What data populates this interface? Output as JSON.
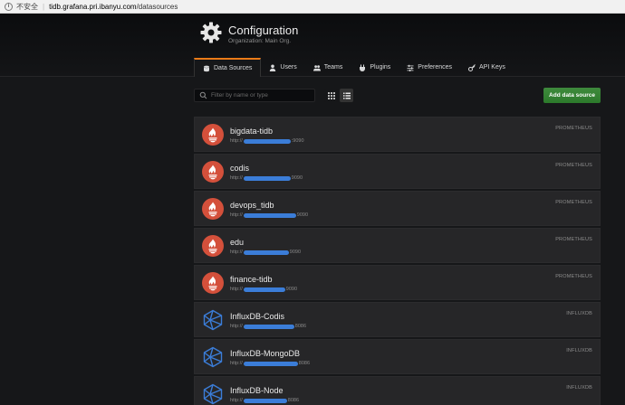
{
  "browser": {
    "security_label": "不安全",
    "url_host": "tidb.grafana.pri.ibanyu.com",
    "url_path": "/datasources"
  },
  "header": {
    "icon": "gear-icon",
    "title": "Configuration",
    "subtitle": "Organization: Main Org."
  },
  "tabs": [
    {
      "label": "Data Sources",
      "icon": "database-icon",
      "active": true
    },
    {
      "label": "Users",
      "icon": "user-icon",
      "active": false
    },
    {
      "label": "Teams",
      "icon": "users-icon",
      "active": false
    },
    {
      "label": "Plugins",
      "icon": "plug-icon",
      "active": false
    },
    {
      "label": "Preferences",
      "icon": "sliders-icon",
      "active": false
    },
    {
      "label": "API Keys",
      "icon": "key-icon",
      "active": false
    }
  ],
  "toolbar": {
    "search_placeholder": "Filter by name or type",
    "add_label": "Add data source"
  },
  "datasources": [
    {
      "name": "bigdata-tidb",
      "url_prefix": "http://",
      "url_suffix": ":9090",
      "type": "PROMETHEUS",
      "logo": "prometheus-logo"
    },
    {
      "name": "codis",
      "url_prefix": "http://",
      "url_suffix": "9090",
      "type": "PROMETHEUS",
      "logo": "prometheus-logo"
    },
    {
      "name": "devops_tidb",
      "url_prefix": "http://",
      "url_suffix": "9090",
      "type": "PROMETHEUS",
      "logo": "prometheus-logo"
    },
    {
      "name": "edu",
      "url_prefix": "http://",
      "url_suffix": "9090",
      "type": "PROMETHEUS",
      "logo": "prometheus-logo"
    },
    {
      "name": "finance-tidb",
      "url_prefix": "http://",
      "url_suffix": "9090",
      "type": "PROMETHEUS",
      "logo": "prometheus-logo"
    },
    {
      "name": "InfluxDB-Codis",
      "url_prefix": "http://",
      "url_suffix": "8086",
      "type": "INFLUXDB",
      "logo": "influxdb-logo"
    },
    {
      "name": "InfluxDB-MongoDB",
      "url_prefix": "http://",
      "url_suffix": "8086",
      "type": "INFLUXDB",
      "logo": "influxdb-logo"
    },
    {
      "name": "InfluxDB-Node",
      "url_prefix": "http://",
      "url_suffix": "8086",
      "type": "INFLUXDB",
      "logo": "influxdb-logo"
    }
  ],
  "colors": {
    "accent": "#eb7b18",
    "add_button": "#2c7a2b",
    "prometheus": "#d4503b",
    "influxdb": "#3b7dd8"
  }
}
